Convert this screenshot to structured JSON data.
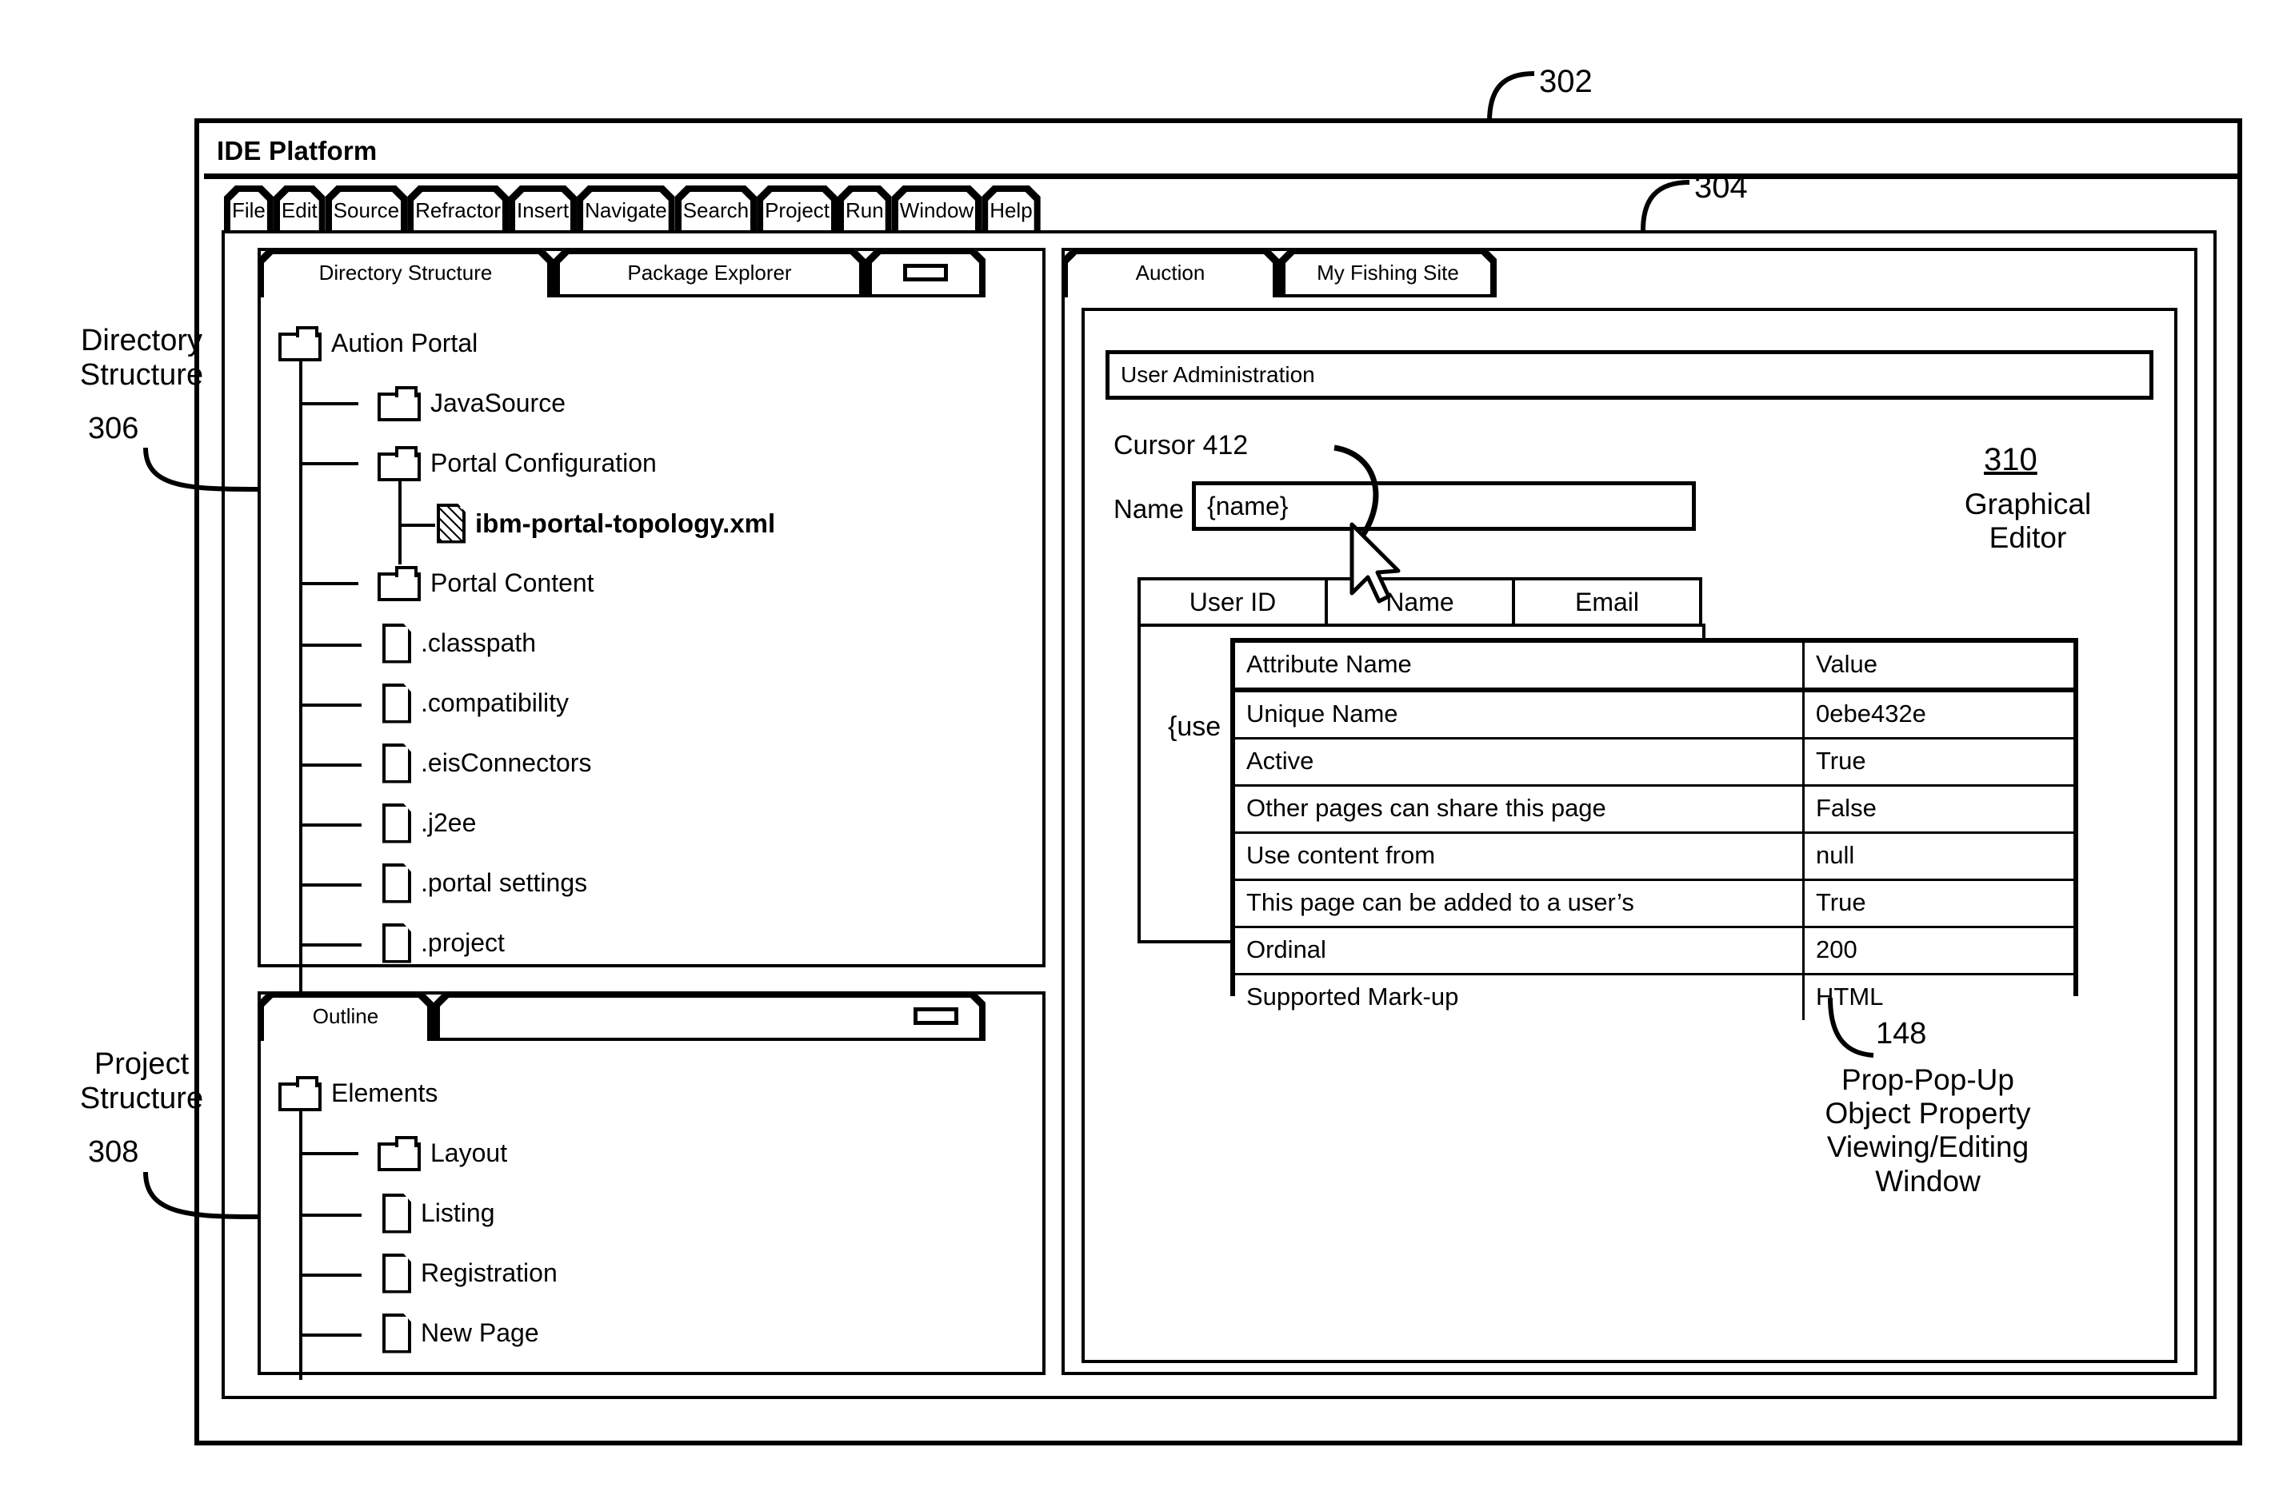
{
  "window": {
    "title": "IDE Platform",
    "ref_label": "302"
  },
  "menubar": {
    "ref_label": "304",
    "items": [
      {
        "label": "File",
        "active": true
      },
      {
        "label": "Edit",
        "active": false
      },
      {
        "label": "Source",
        "active": false
      },
      {
        "label": "Refractor",
        "active": false
      },
      {
        "label": "Insert",
        "active": false
      },
      {
        "label": "Navigate",
        "active": false
      },
      {
        "label": "Search",
        "active": false
      },
      {
        "label": "Project",
        "active": false
      },
      {
        "label": "Run",
        "active": false
      },
      {
        "label": "Window",
        "active": false
      },
      {
        "label": "Help",
        "active": false
      }
    ]
  },
  "left_panel": {
    "tabs": [
      {
        "label": "Directory Structure",
        "active": true
      },
      {
        "label": "Package Explorer",
        "active": false
      }
    ],
    "restore_button_icon": "restore-icon",
    "annotation": {
      "title": "Directory\nStructure",
      "ref_label": "306"
    },
    "tree": [
      {
        "label": "Aution Portal",
        "icon": "folder-icon",
        "depth": 0,
        "bold": false
      },
      {
        "label": "JavaSource",
        "icon": "folder-icon",
        "depth": 1,
        "bold": false
      },
      {
        "label": "Portal Configuration",
        "icon": "folder-icon",
        "depth": 1,
        "bold": false
      },
      {
        "label": "ibm-portal-topology.xml",
        "icon": "xml-file-icon",
        "depth": 2,
        "bold": true
      },
      {
        "label": "Portal Content",
        "icon": "folder-icon",
        "depth": 1,
        "bold": false
      },
      {
        "label": ".classpath",
        "icon": "file-icon",
        "depth": 1,
        "bold": false
      },
      {
        "label": ".compatibility",
        "icon": "file-icon",
        "depth": 1,
        "bold": false
      },
      {
        "label": ".eisConnectors",
        "icon": "file-icon",
        "depth": 1,
        "bold": false
      },
      {
        "label": ".j2ee",
        "icon": "file-icon",
        "depth": 1,
        "bold": false
      },
      {
        "label": ".portal settings",
        "icon": "file-icon",
        "depth": 1,
        "bold": false
      },
      {
        "label": ".project",
        "icon": "file-icon",
        "depth": 1,
        "bold": false
      }
    ]
  },
  "outline_panel": {
    "tabs": [
      {
        "label": "Outline",
        "active": true
      }
    ],
    "restore_button_icon": "restore-icon",
    "annotation": {
      "title": "Project\nStructure",
      "ref_label": "308"
    },
    "tree": [
      {
        "label": "Elements",
        "icon": "folder-icon",
        "depth": 0
      },
      {
        "label": "Layout",
        "icon": "folder-icon",
        "depth": 1
      },
      {
        "label": "Listing",
        "icon": "file-icon",
        "depth": 1
      },
      {
        "label": "Registration",
        "icon": "file-icon",
        "depth": 1
      },
      {
        "label": "New Page",
        "icon": "file-icon",
        "depth": 1
      }
    ]
  },
  "editor_panel": {
    "tabs": [
      {
        "label": "Auction",
        "active": true
      },
      {
        "label": "My Fishing Site",
        "active": false
      }
    ],
    "header_bar": "User Administration",
    "annotation": {
      "ref_label": "310",
      "title": "Graphical\nEditor"
    },
    "cursor_annotation": "Cursor  412",
    "cursor_icon": "mouse-pointer-icon",
    "name_form": {
      "label": "Name",
      "value": "{name}"
    },
    "user_table": {
      "columns": [
        "User ID",
        "Name",
        "Email"
      ],
      "row_value": "{use"
    }
  },
  "prop_popup": {
    "ref_label": "148",
    "annotation": "Prop-Pop-Up\nObject Property\nViewing/Editing\nWindow",
    "columns": [
      "Attribute Name",
      "Value"
    ],
    "rows": [
      {
        "name": "Unique Name",
        "value": "0ebe432e"
      },
      {
        "name": "Active",
        "value": "True"
      },
      {
        "name": "Other pages can share this page",
        "value": "False"
      },
      {
        "name": "Use content from",
        "value": "null"
      },
      {
        "name": "This page can be added to a user’s",
        "value": "True"
      },
      {
        "name": "Ordinal",
        "value": "200"
      },
      {
        "name": "Supported Mark-up",
        "value": "HTML"
      }
    ]
  },
  "colors": {
    "ink": "#000000",
    "paper": "#ffffff"
  }
}
